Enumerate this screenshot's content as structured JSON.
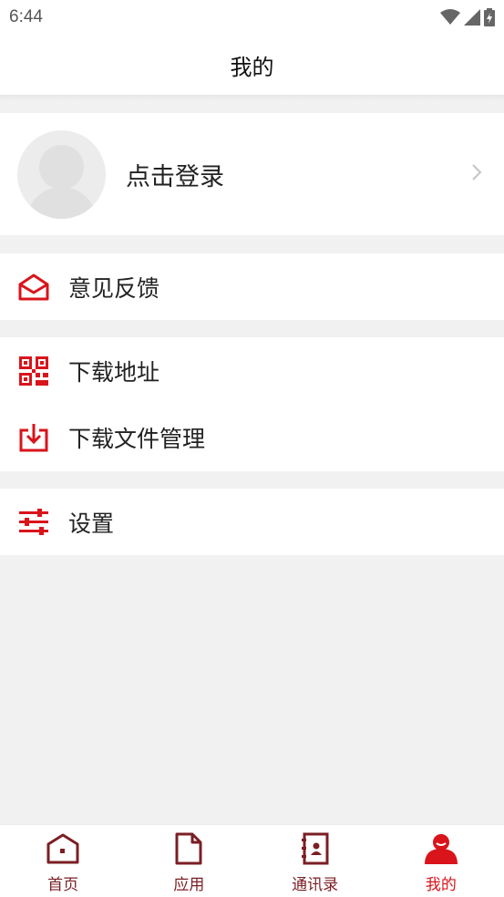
{
  "status_bar": {
    "time": "6:44"
  },
  "header": {
    "title": "我的"
  },
  "profile": {
    "login_label": "点击登录"
  },
  "menu": {
    "feedback": "意见反馈",
    "download_address": "下载地址",
    "download_files": "下载文件管理",
    "settings": "设置"
  },
  "bottom_nav": {
    "items": [
      {
        "label": "首页",
        "icon": "home-icon"
      },
      {
        "label": "应用",
        "icon": "document-icon"
      },
      {
        "label": "通讯录",
        "icon": "contacts-icon"
      },
      {
        "label": "我的",
        "icon": "user-icon",
        "active": true
      }
    ]
  },
  "colors": {
    "accent": "#d9141b",
    "nav_inactive": "#7a1f24",
    "background": "#f1f1f1"
  }
}
